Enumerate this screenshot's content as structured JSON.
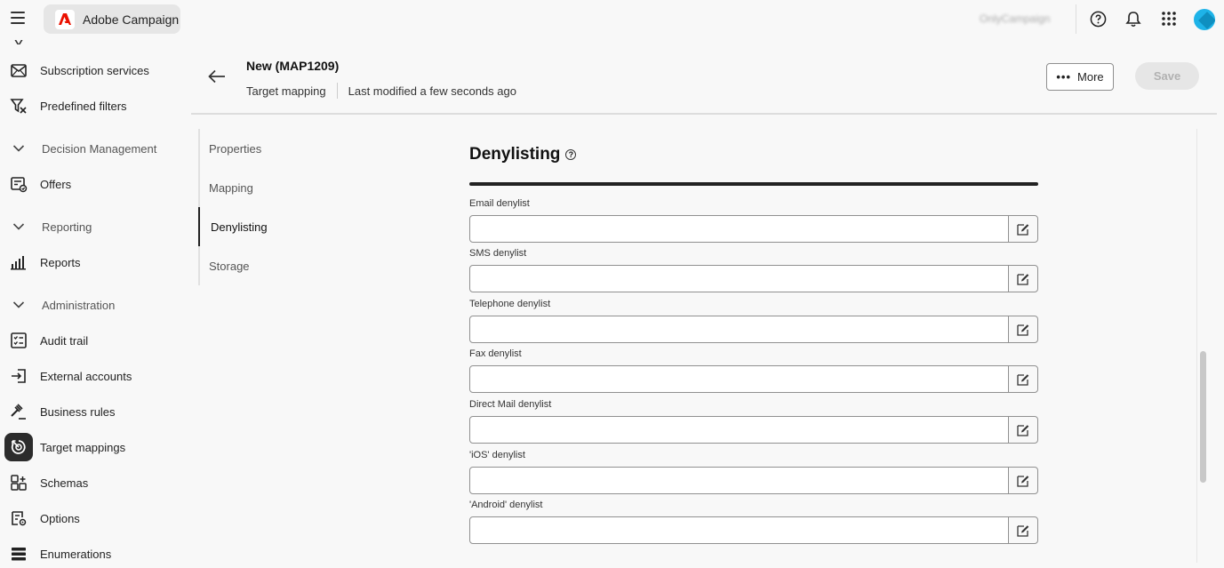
{
  "app": {
    "name": "Adobe Campaign",
    "org": "OnlyCampaign"
  },
  "topbar_icons": [
    "help-icon",
    "bell-icon",
    "apps-grid-icon",
    "avatar"
  ],
  "sidebar": {
    "items": [
      {
        "label": "Subscription services",
        "icon": "envelope-icon"
      },
      {
        "label": "Predefined filters",
        "icon": "filter-icon"
      },
      {
        "label": "Decision Management",
        "section": true
      },
      {
        "label": "Offers",
        "icon": "offers-icon"
      },
      {
        "label": "Reporting",
        "section": true
      },
      {
        "label": "Reports",
        "icon": "bar-chart-icon"
      },
      {
        "label": "Administration",
        "section": true
      },
      {
        "label": "Audit trail",
        "icon": "checklist-icon"
      },
      {
        "label": "External accounts",
        "icon": "login-icon"
      },
      {
        "label": "Business rules",
        "icon": "gavel-icon"
      },
      {
        "label": "Target mappings",
        "icon": "target-icon",
        "active": true
      },
      {
        "label": "Schemas",
        "icon": "schema-icon"
      },
      {
        "label": "Options",
        "icon": "options-icon"
      },
      {
        "label": "Enumerations",
        "icon": "enumerations-icon"
      }
    ]
  },
  "header": {
    "title": "New (MAP1209)",
    "type": "Target mapping",
    "modified": "Last modified a few seconds ago",
    "more_label": "More",
    "save_label": "Save"
  },
  "subnav": {
    "items": [
      "Properties",
      "Mapping",
      "Denylisting",
      "Storage"
    ],
    "active": "Denylisting"
  },
  "section": {
    "title": "Denylisting",
    "fields": [
      {
        "label": "Email denylist",
        "value": ""
      },
      {
        "label": "SMS denylist",
        "value": ""
      },
      {
        "label": "Telephone denylist",
        "value": ""
      },
      {
        "label": "Fax denylist",
        "value": ""
      },
      {
        "label": "Direct Mail denylist",
        "value": ""
      },
      {
        "label": "'iOS' denylist",
        "value": ""
      },
      {
        "label": "'Android' denylist",
        "value": ""
      }
    ]
  },
  "colors": {
    "accent": "#1eb3e8",
    "brand_red": "#eb1000",
    "active_nav": "#2c2c2c"
  }
}
